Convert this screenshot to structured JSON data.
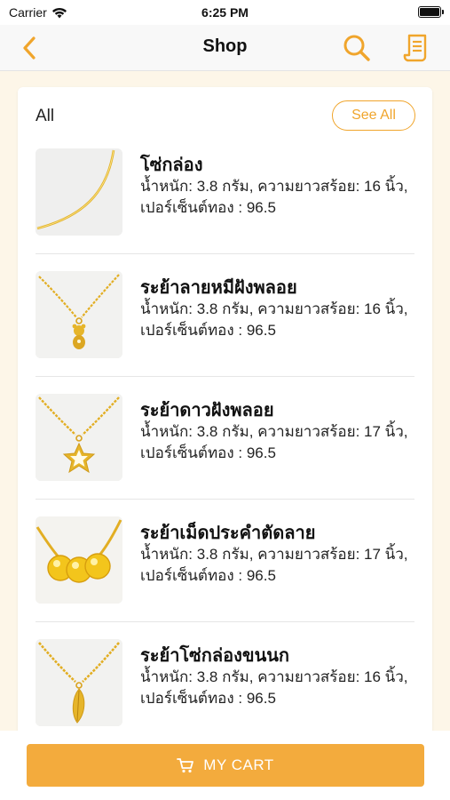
{
  "status_bar": {
    "carrier": "Carrier",
    "time": "6:25 PM"
  },
  "nav": {
    "title": "Shop",
    "back_icon": "chevron-left-icon",
    "search_icon": "search-icon",
    "receipt_icon": "receipt-icon"
  },
  "section": {
    "title": "All",
    "see_all_label": "See All"
  },
  "items": [
    {
      "name": "โซ่กล่อง",
      "desc_line1": "น้ำหนัก: 3.8 กรัม, ความยาวสร้อย: 16 นิ้ว,",
      "desc_line2": "เปอร์เซ็นต์ทอง : 96.5"
    },
    {
      "name": "ระย้าลายหมีฝังพลอย",
      "desc_line1": "น้ำหนัก: 3.8 กรัม, ความยาวสร้อย: 16 นิ้ว,",
      "desc_line2": "เปอร์เซ็นต์ทอง : 96.5"
    },
    {
      "name": "ระย้าดาวฝังพลอย",
      "desc_line1": "น้ำหนัก: 3.8 กรัม, ความยาวสร้อย: 17 นิ้ว,",
      "desc_line2": "เปอร์เซ็นต์ทอง : 96.5"
    },
    {
      "name": "ระย้าเม็ดประคำตัดลาย",
      "desc_line1": "น้ำหนัก: 3.8 กรัม, ความยาวสร้อย: 17 นิ้ว,",
      "desc_line2": "เปอร์เซ็นต์ทอง : 96.5"
    },
    {
      "name": "ระย้าโซ่กล่องขนนก",
      "desc_line1": "น้ำหนัก: 3.8 กรัม, ความยาวสร้อย: 16 นิ้ว,",
      "desc_line2": "เปอร์เซ็นต์ทอง : 96.5"
    }
  ],
  "cart": {
    "label": "MY CART",
    "icon": "cart-icon"
  },
  "colors": {
    "accent": "#f0a52c",
    "cart_button": "#f3ab3d",
    "background": "#fdf6e8",
    "gold": "#e8b520"
  }
}
